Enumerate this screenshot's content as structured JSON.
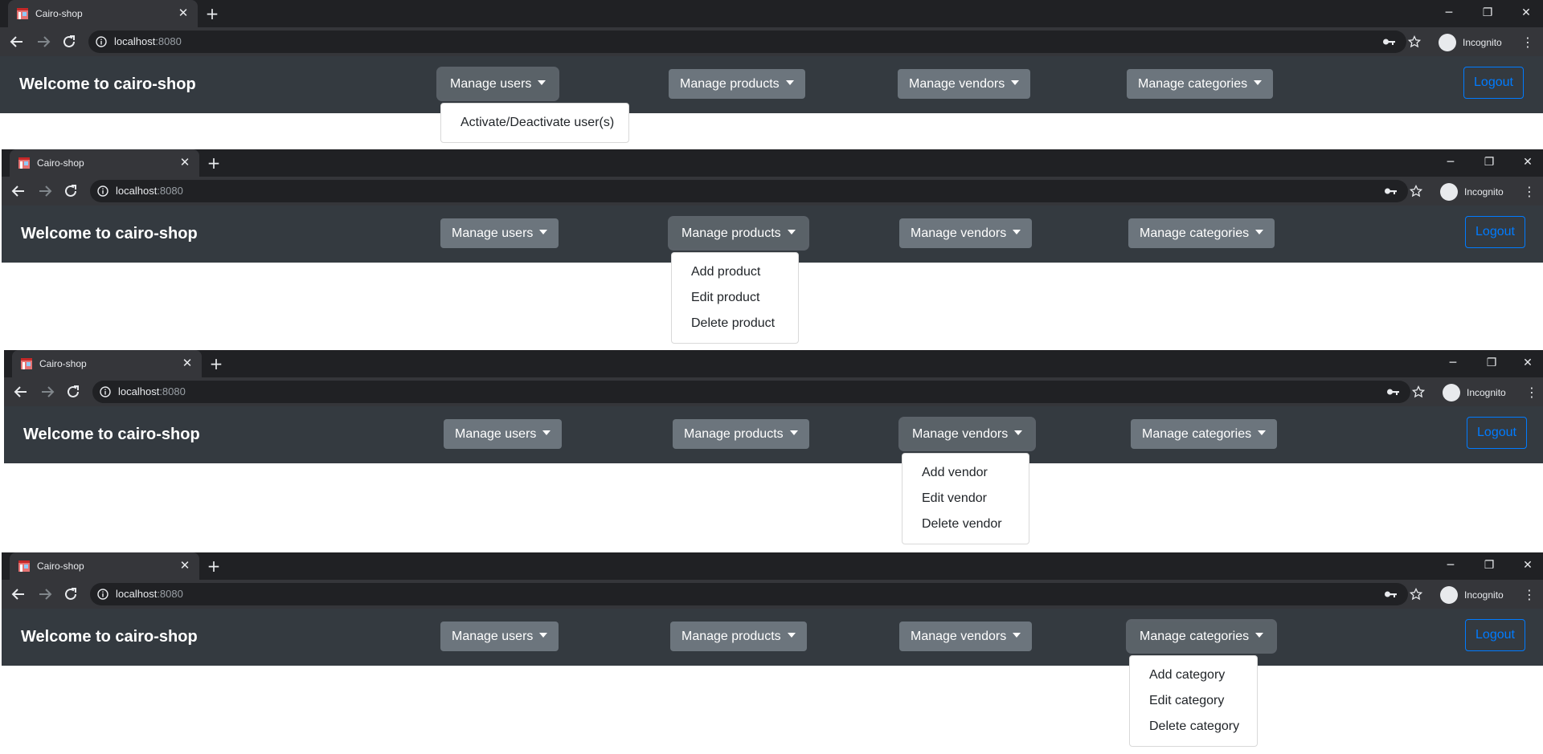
{
  "browser": {
    "tab_title": "Cairo-shop",
    "url_host": "localhost",
    "url_port": ":8080",
    "profile_label": "Incognito"
  },
  "site": {
    "brand": "Welcome to cairo-shop",
    "logout_label": "Logout",
    "nav": {
      "users": "Manage users",
      "products": "Manage products",
      "vendors": "Manage vendors",
      "categories": "Manage categories"
    }
  },
  "menus": {
    "users": [
      "Activate/Deactivate user(s)"
    ],
    "products": [
      "Add product",
      "Edit product",
      "Delete product"
    ],
    "vendors": [
      "Add vendor",
      "Edit vendor",
      "Delete vendor"
    ],
    "categories": [
      "Add category",
      "Edit category",
      "Delete category"
    ]
  },
  "colors": {
    "tab_strip": "#202124",
    "toolbar": "#35363a",
    "navbar": "#343a40",
    "dropdown_button": "#6c757d",
    "logout_accent": "#007bff"
  }
}
